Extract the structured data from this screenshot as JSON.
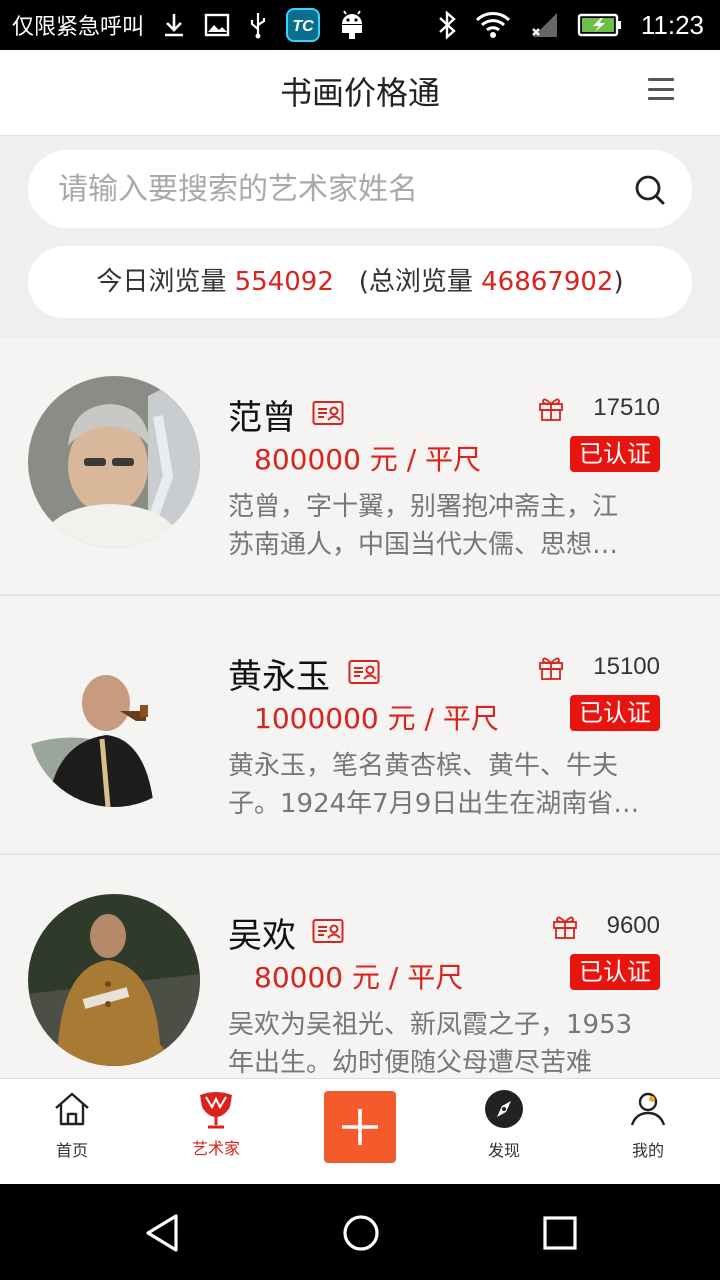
{
  "status_bar": {
    "carrier": "仅限紧急呼叫",
    "time": "11:23",
    "icons": [
      "download-icon",
      "image-icon",
      "usb-icon",
      "tc-app-icon",
      "android-icon",
      "bluetooth-icon",
      "wifi-icon",
      "signal-icon",
      "battery-charging-icon"
    ]
  },
  "header": {
    "title": "书画价格通",
    "menu_icon": "menu-icon"
  },
  "search": {
    "placeholder": "请输入要搜索的艺术家姓名",
    "icon": "search-icon"
  },
  "stats": {
    "today_label": "今日浏览量",
    "today_value": "554092",
    "total_open": "(总浏览量",
    "total_value": "46867902",
    "total_close": ")"
  },
  "artists": [
    {
      "name": "范曾",
      "views": "17510",
      "price": "800000 元 / 平尺",
      "badge": "已认证",
      "desc_line1": "范曾，字十翼，别署抱冲斋主，江",
      "desc_line2": "苏南通人，中国当代大儒、思想…"
    },
    {
      "name": "黄永玉",
      "views": "15100",
      "price": "1000000 元 / 平尺",
      "badge": "已认证",
      "desc_line1": "黄永玉，笔名黄杏槟、黄牛、牛夫",
      "desc_line2": "子。1924年7月9日出生在湖南省…"
    },
    {
      "name": "吴欢",
      "views": "9600",
      "price": "80000 元 / 平尺",
      "badge": "已认证",
      "desc_line1": "吴欢为吴祖光、新凤霞之子，1953",
      "desc_line2": "年出生。幼时便随父母遭尽苦难"
    }
  ],
  "tabs": [
    {
      "label": "首页",
      "icon": "home-icon"
    },
    {
      "label": "艺术家",
      "icon": "artist-icon",
      "active": true
    },
    {
      "label": "",
      "icon": "plus-icon"
    },
    {
      "label": "发现",
      "icon": "discover-icon"
    },
    {
      "label": "我的",
      "icon": "profile-icon"
    }
  ],
  "colors": {
    "accent": "#d9231c",
    "verified_bg": "#e8140f",
    "plus_bg": "#f55a2c"
  }
}
